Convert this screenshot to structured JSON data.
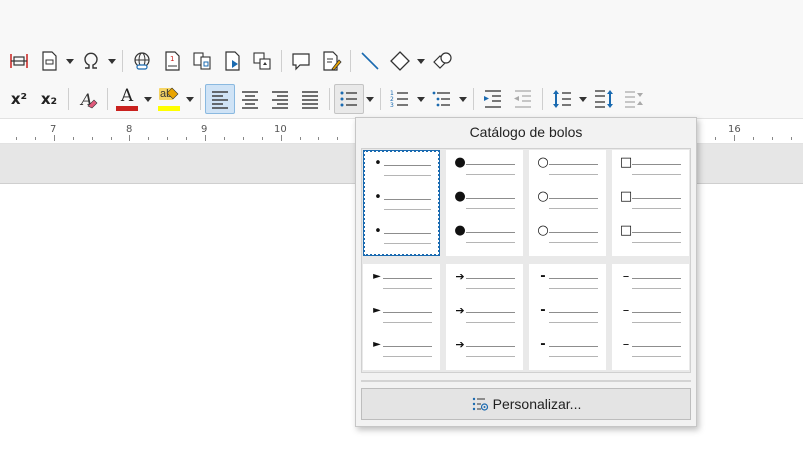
{
  "ruler": {
    "numbers": [
      "7",
      "8",
      "9",
      "10",
      "16"
    ]
  },
  "popup": {
    "title": "Catálogo de bolos",
    "customize_label": "Personalizar...",
    "bullets_row1": [
      "•",
      "●",
      "○",
      "□"
    ],
    "bullets_row2": [
      "►",
      "➔",
      "-",
      "–"
    ]
  },
  "toolbar": {
    "superscript_icon": "x²",
    "subscript_icon": "x₂",
    "font_color_letter": "A",
    "highlight_letters": "ab"
  },
  "colors": {
    "font_color": "#c9211e",
    "highlight_color": "#ffff00",
    "accent": "#1a6ab0",
    "selection_bg": "#cfe3f6"
  },
  "icons": [
    "table-icon",
    "insert-field-icon",
    "special-character-icon",
    "hyperlink-icon",
    "footnote-icon",
    "cross-reference-icon",
    "bookmark-icon",
    "caption-icon",
    "comment-icon",
    "track-changes-icon",
    "line-icon",
    "basic-shapes-icon",
    "draw-shape-icon"
  ]
}
